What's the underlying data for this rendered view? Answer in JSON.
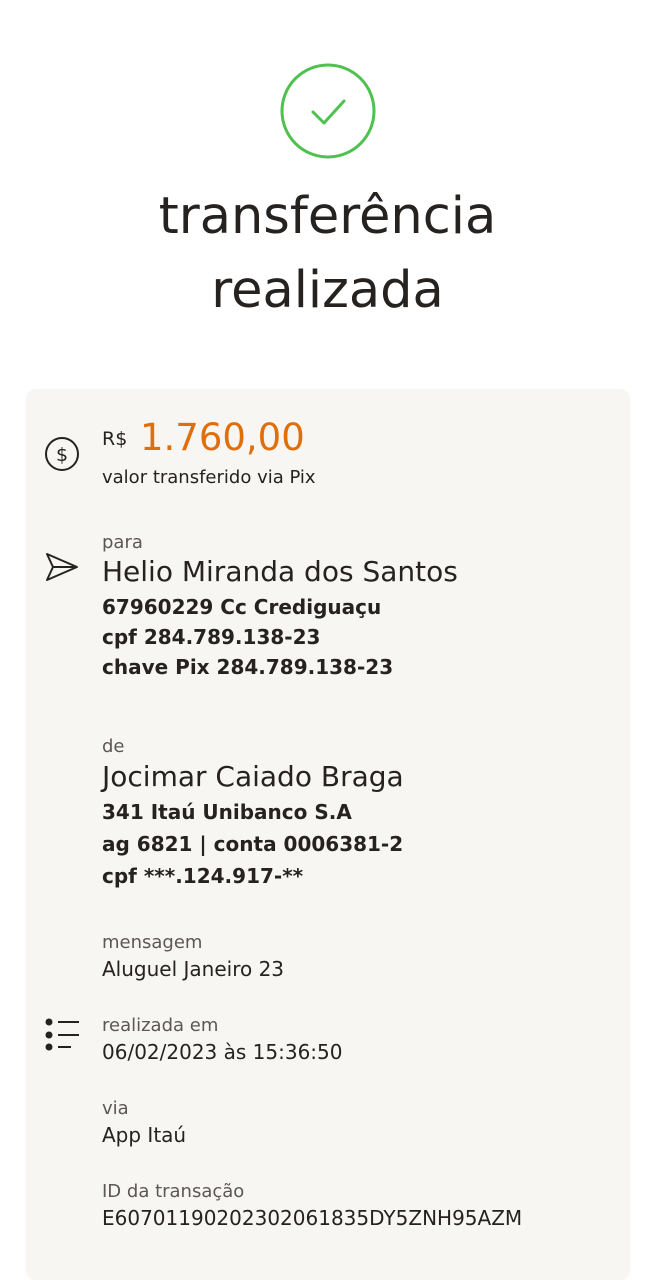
{
  "header": {
    "title_line1": "transferência",
    "title_line2": "realizada",
    "success_color": "#4fc14f"
  },
  "amount": {
    "currency": "R$",
    "value": "1.760,00",
    "caption": "valor transferido via Pix",
    "color": "#e06e0a"
  },
  "recipient": {
    "label": "para",
    "name": "Helio Miranda dos Santos",
    "account": "67960229 Cc Crediguaçu",
    "cpf": "cpf 284.789.138-23",
    "pix_key": "chave Pix 284.789.138-23"
  },
  "sender": {
    "label": "de",
    "name": "Jocimar Caiado Braga",
    "bank": "341 Itaú Unibanco S.A",
    "agency_account": "ag 6821 | conta 0006381-2",
    "cpf": "cpf ***.124.917-**"
  },
  "details": {
    "message_label": "mensagem",
    "message": "Aluguel Janeiro 23",
    "date_label": "realizada em",
    "date": "06/02/2023 às 15:36:50",
    "via_label": "via",
    "via": "App Itaú",
    "id_label": "ID da transação",
    "id": "E60701190202302061835DY5ZNH95AZM"
  },
  "icons": {
    "success": "check-circle-icon",
    "amount": "dollar-circle-icon",
    "recipient": "send-icon",
    "details": "list-icon"
  }
}
